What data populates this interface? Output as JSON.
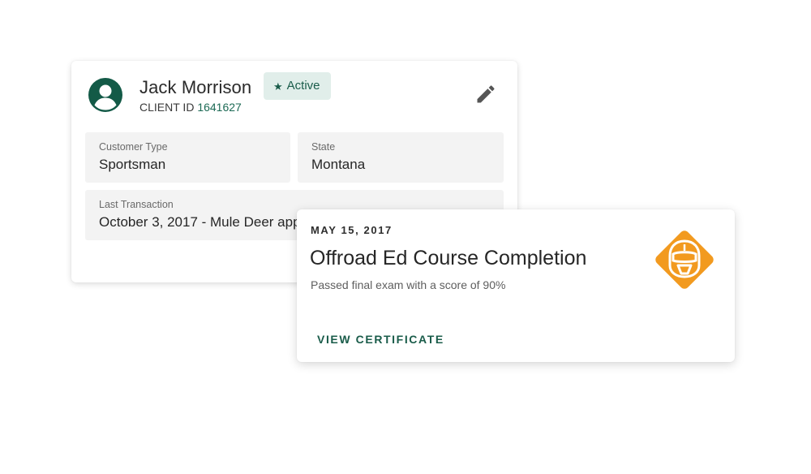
{
  "client": {
    "name": "Jack Morrison",
    "status_badge": "Active",
    "client_id_label": "CLIENT ID",
    "client_id_value": "1641627",
    "fields": {
      "customer_type": {
        "label": "Customer Type",
        "value": "Sportsman"
      },
      "state": {
        "label": "State",
        "value": "Montana"
      },
      "last_transaction": {
        "label": "Last Transaction",
        "value": "October 3, 2017 - Mule Deer app"
      }
    }
  },
  "achievement": {
    "date": "MAY 15, 2017",
    "title": "Offroad Ed Course Completion",
    "subtitle": "Passed final exam with a score of 90%",
    "action_label": "VIEW CERTIFICATE",
    "badge_icon": "offroad-helmet-icon"
  },
  "icons": {
    "avatar": "account-circle-icon",
    "status": "star-icon",
    "edit": "pencil-icon"
  },
  "colors": {
    "brand_green": "#135a47",
    "badge_bg": "#e1eeea",
    "badge_orange": "#f29a1f",
    "field_bg": "#f3f3f3"
  }
}
